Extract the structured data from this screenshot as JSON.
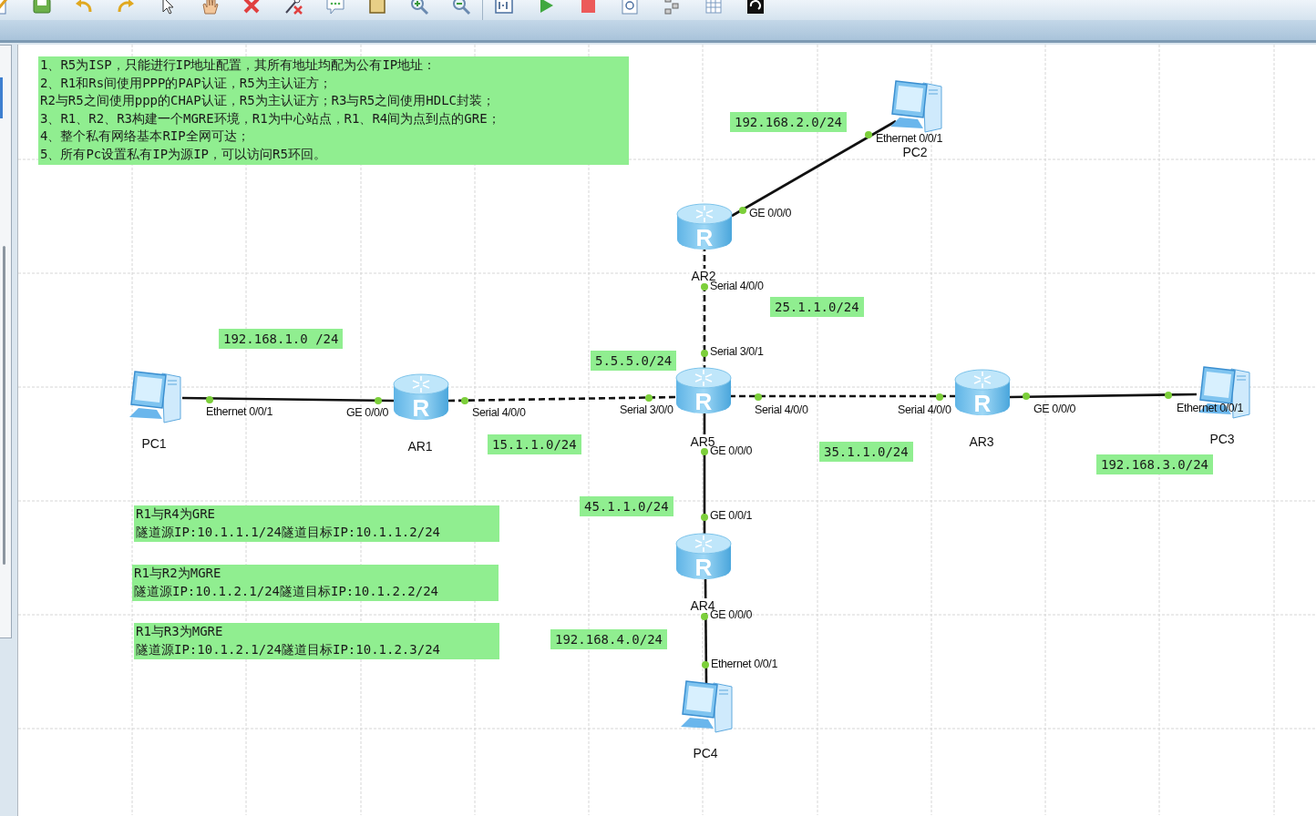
{
  "toolbar": {
    "buttons": [
      {
        "kind": "edit"
      },
      {
        "kind": "save"
      },
      {
        "kind": "undo"
      },
      {
        "kind": "redo"
      },
      {
        "kind": "select"
      },
      {
        "kind": "pan"
      },
      {
        "kind": "delete"
      },
      {
        "kind": "delete-link"
      },
      {
        "kind": "comment"
      },
      {
        "kind": "rectangle"
      },
      {
        "kind": "zoom-in"
      },
      {
        "kind": "zoom-out"
      },
      {
        "kind": "fit"
      },
      {
        "kind": "start"
      },
      {
        "kind": "stop"
      },
      {
        "kind": "capture"
      },
      {
        "kind": "topology"
      },
      {
        "kind": "grid"
      },
      {
        "kind": "terminal"
      }
    ]
  },
  "notes": [
    {
      "lines": [
        "1、R5为ISP，只能进行IP地址配置，其所有地址均配为公有IP地址：",
        "2、R1和Rs间使用PPP的PAP认证，R5为主认证方；",
        "R2与R5之间使用ppp的CHAP认证，R5为主认证方；R3与R5之间使用HDLC封装；",
        "3、R1、R2、R3构建一个MGRE环境，R1为中心站点，R1、R4间为点到点的GRE；",
        "4、整个私有网络基本RIP全网可达；",
        "5、所有Pc设置私有IP为源IP，可以访问R5环回。"
      ]
    },
    {
      "lines": [
        "R1与R4为GRE",
        "隧道源IP:10.1.1.1/24隧道目标IP:10.1.1.2/24"
      ]
    },
    {
      "lines": [
        "R1与R2为MGRE",
        "隧道源IP:10.1.2.1/24隧道目标IP:10.1.2.2/24"
      ]
    },
    {
      "lines": [
        "R1与R3为MGRE",
        "隧道源IP:10.1.2.1/24隧道目标IP:10.1.2.3/24"
      ]
    }
  ],
  "devices": [
    {
      "kind": "pc",
      "label": "PC2"
    },
    {
      "kind": "router",
      "label": "AR2",
      "glyph": "R"
    },
    {
      "kind": "pc",
      "label": "PC1"
    },
    {
      "kind": "router",
      "label": "AR1",
      "glyph": "R"
    },
    {
      "kind": "router",
      "label": "AR5",
      "glyph": "R"
    },
    {
      "kind": "router",
      "label": "AR3",
      "glyph": "R"
    },
    {
      "kind": "pc",
      "label": "PC3"
    },
    {
      "kind": "router",
      "label": "AR4",
      "glyph": "R"
    },
    {
      "kind": "pc",
      "label": "PC4"
    }
  ],
  "links": [
    {
      "kind": "ethernet",
      "ports": [
        "GE 0/0/0",
        "Ethernet 0/0/1"
      ]
    },
    {
      "kind": "serial",
      "ports": [
        "Serial 4/0/0",
        "Serial 3/0/1"
      ]
    },
    {
      "kind": "ethernet",
      "ports": [
        "Ethernet 0/0/1",
        "GE 0/0/0"
      ]
    },
    {
      "kind": "serial",
      "ports": [
        "Serial 4/0/0",
        "Serial 3/0/0"
      ]
    },
    {
      "kind": "serial",
      "ports": [
        "Serial 4/0/0",
        "Serial 4/0/0"
      ]
    },
    {
      "kind": "ethernet",
      "ports": [
        "GE 0/0/0",
        "Ethernet 0/0/1"
      ]
    },
    {
      "kind": "ethernet",
      "ports": [
        "GE 0/0/0",
        "GE 0/0/1"
      ]
    },
    {
      "kind": "ethernet",
      "ports": [
        "GE 0/0/0",
        "Ethernet 0/0/1"
      ]
    }
  ],
  "subnets": [
    {
      "label": "192.168.2.0/24"
    },
    {
      "label": "25.1.1.0/24"
    },
    {
      "label": "192.168.1.0 /24"
    },
    {
      "label": "5.5.5.0/24"
    },
    {
      "label": "15.1.1.0/24"
    },
    {
      "label": "35.1.1.0/24"
    },
    {
      "label": "192.168.3.0/24"
    },
    {
      "label": "45.1.1.0/24"
    },
    {
      "label": "192.168.4.0/24"
    }
  ]
}
